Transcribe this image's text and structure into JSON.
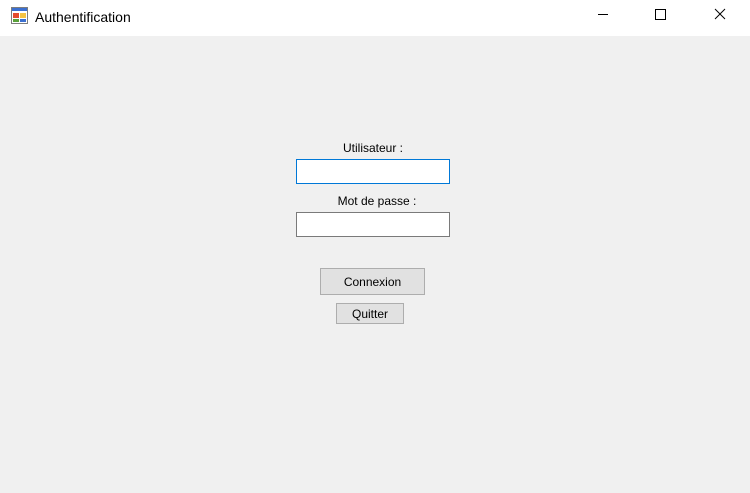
{
  "window": {
    "title": "Authentification",
    "app_icon": "winforms-app-icon",
    "controls": {
      "minimize_icon": "minimize-icon",
      "maximize_icon": "maximize-icon",
      "close_icon": "close-icon"
    }
  },
  "form": {
    "user_label": "Utilisateur :",
    "user_value": "",
    "password_label": "Mot de passe :",
    "password_value": "",
    "connect_button": "Connexion",
    "quit_button": "Quitter"
  },
  "colors": {
    "background": "#f0f0f0",
    "titlebar": "#ffffff",
    "focus_border": "#0078d7",
    "button_face": "#e1e1e1"
  }
}
